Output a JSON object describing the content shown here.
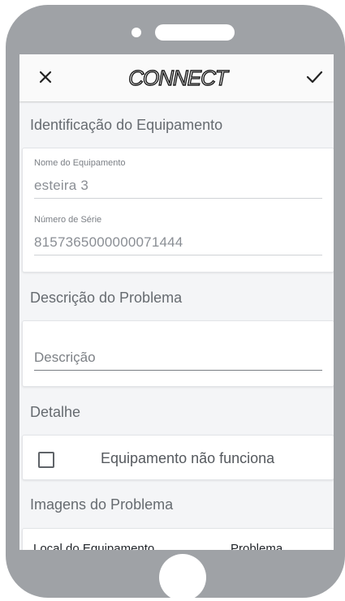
{
  "header": {
    "close_icon": "close-icon",
    "logo_text": "CONNECT",
    "confirm_icon": "check-icon"
  },
  "sections": {
    "identification": "Identificação do Equipamento",
    "problem_description": "Descrição do Problema",
    "detail": "Detalhe",
    "images": "Imagens do Problema"
  },
  "equipment": {
    "name_label": "Nome do Equipamento",
    "name_value": "esteira 3",
    "serial_label": "Número de Série",
    "serial_value": "8157365000000071444"
  },
  "description": {
    "placeholder": "Descrição"
  },
  "detail": {
    "checkbox_label": "Equipamento não funciona",
    "checked": false
  },
  "images": {
    "col_location": "Local do Equipamento",
    "col_problem": "Problema"
  },
  "colors": {
    "device_frame": "#9fa2a6",
    "screen_bg": "#f4f5f7",
    "card_bg": "#ffffff"
  }
}
